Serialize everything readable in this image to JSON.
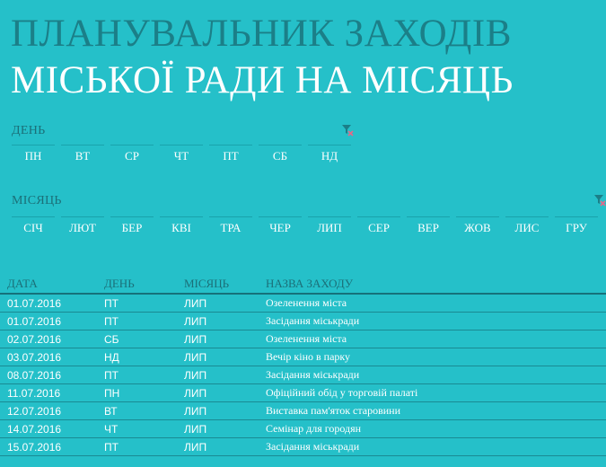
{
  "title": {
    "line1": "ПЛАНУВАЛЬНИК ЗАХОДІВ",
    "line2": "МІСЬКОЇ РАДИ НА МІСЯЦЬ"
  },
  "day_slicer": {
    "title": "ДЕНЬ",
    "items": [
      "ПН",
      "ВТ",
      "СР",
      "ЧТ",
      "ПТ",
      "СБ",
      "НД"
    ]
  },
  "month_slicer": {
    "title": "МІСЯЦЬ",
    "items": [
      "СІЧ",
      "ЛЮТ",
      "БЕР",
      "КВІ",
      "ТРА",
      "ЧЕР",
      "ЛИП",
      "СЕР",
      "ВЕР",
      "ЖОВ",
      "ЛИС",
      "ГРУ"
    ]
  },
  "table": {
    "headers": [
      "ДАТА",
      "ДЕНЬ",
      "МІСЯЦЬ",
      "НАЗВА ЗАХОДУ"
    ],
    "rows": [
      [
        "01.07.2016",
        "ПТ",
        "ЛИП",
        "Озеленення міста"
      ],
      [
        "01.07.2016",
        "ПТ",
        "ЛИП",
        "Засідання міськради"
      ],
      [
        "02.07.2016",
        "СБ",
        "ЛИП",
        "Озеленення міста"
      ],
      [
        "03.07.2016",
        "НД",
        "ЛИП",
        "Вечір кіно в парку"
      ],
      [
        "08.07.2016",
        "ПТ",
        "ЛИП",
        "Засідання міськради"
      ],
      [
        "11.07.2016",
        "ПН",
        "ЛИП",
        "Офіційний обід у торговій палаті"
      ],
      [
        "12.07.2016",
        "ВТ",
        "ЛИП",
        "Виставка пам'яток старовини"
      ],
      [
        "14.07.2016",
        "ЧТ",
        "ЛИП",
        "Семінар для городян"
      ],
      [
        "15.07.2016",
        "ПТ",
        "ЛИП",
        "Засідання міськради"
      ]
    ]
  },
  "colors": {
    "background": "#25c0c9",
    "title_dark": "#1b7f88",
    "title_light": "#ffffff",
    "clear_filter_icon": "#e06b8a"
  },
  "icons": {
    "clear_filter": "clear-filter-icon"
  }
}
